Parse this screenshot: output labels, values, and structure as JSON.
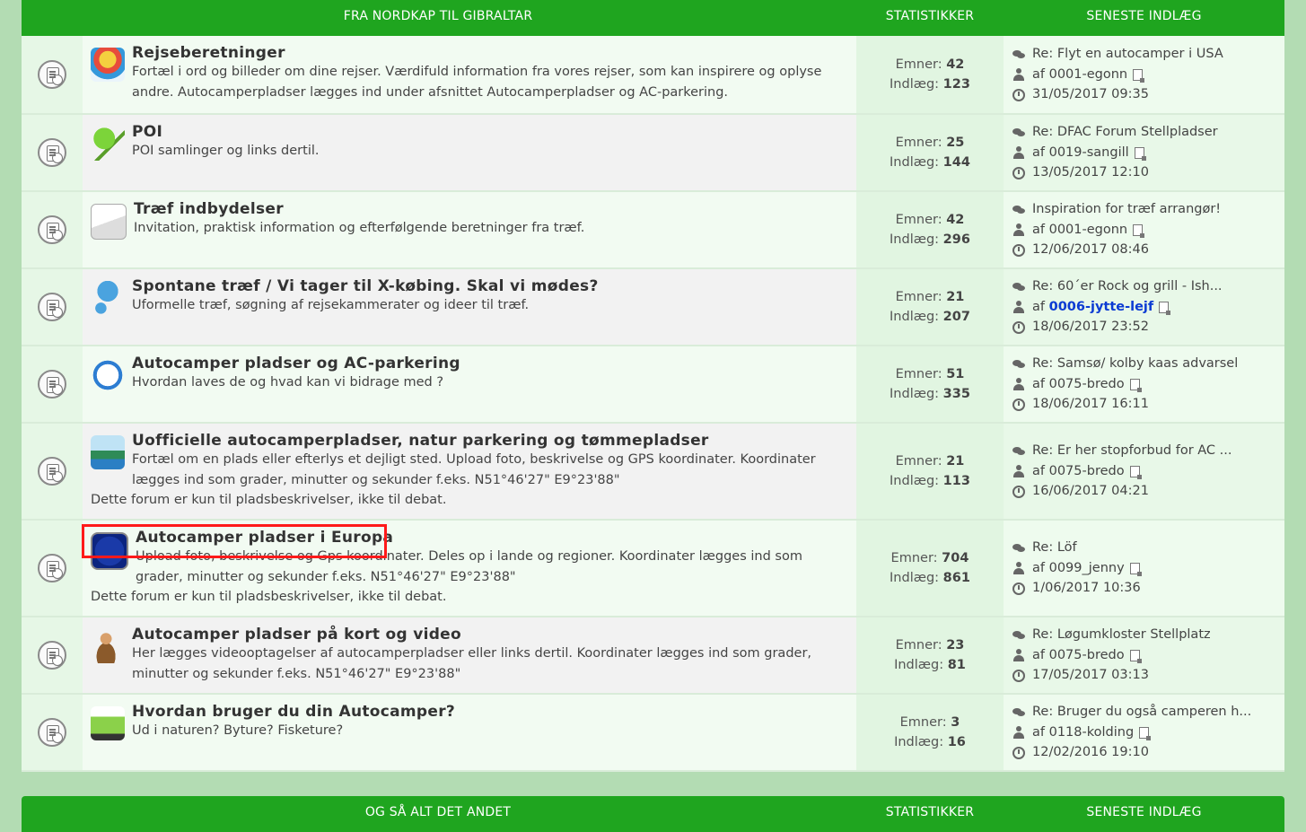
{
  "section1": {
    "header": {
      "title": "FRA NORDKAP TIL GIBRALTAR",
      "stats": "STATISTIKKER",
      "last": "SENESTE INDLÆG"
    },
    "rows": [
      {
        "title": "Rejseberetninger",
        "desc": "Fortæl i ord og billeder om dine rejser. Værdifuld information fra vores rejser, som kan inspirere og oplyse andre. Autocamperpladser lægges ind under afsnittet Autocamperpladser og AC-parkering.",
        "note": "",
        "topics_label": "Emner:",
        "topics": "42",
        "posts_label": "Indlæg:",
        "posts": "123",
        "last_title": "Re: Flyt en autocamper i USA",
        "by": "af",
        "last_user": "0001-egonn",
        "last_date": "31/05/2017 09:35",
        "icon": "hot-air-balloon-icon"
      },
      {
        "title": "POI",
        "desc": "POI samlinger og links dertil.",
        "note": "",
        "topics_label": "Emner:",
        "topics": "25",
        "posts_label": "Indlæg:",
        "posts": "144",
        "last_title": "Re: DFAC Forum Stellpladser",
        "by": "af",
        "last_user": "0019-sangill",
        "last_date": "13/05/2017 12:10",
        "icon": "pushpin-icon"
      },
      {
        "title": "Træf indbydelser",
        "desc": "Invitation, praktisk information og efterfølgende beretninger fra træf.",
        "note": "",
        "topics_label": "Emner:",
        "topics": "42",
        "posts_label": "Indlæg:",
        "posts": "296",
        "last_title": "Inspiration for træf arrangør!",
        "by": "af",
        "last_user": "0001-egonn",
        "last_date": "12/06/2017 08:46",
        "icon": "envelope-icon"
      },
      {
        "title": "Spontane træf / Vi tager til X-købing. Skal vi mødes?",
        "desc": "Uformelle træf, søgning af rejsekammerater og ideer til træf.",
        "note": "",
        "topics_label": "Emner:",
        "topics": "21",
        "posts_label": "Indlæg:",
        "posts": "207",
        "last_title": "Re: 60´er Rock og grill - Ish...",
        "by": "af",
        "last_user": "0006-jytte-lejf",
        "last_date": "18/06/2017 23:52",
        "icon": "umbrella-icon"
      },
      {
        "title": "Autocamper pladser og AC-parkering",
        "desc": "Hvordan laves de og hvad kan vi bidrage med ?",
        "note": "",
        "topics_label": "Emner:",
        "topics": "51",
        "posts_label": "Indlæg:",
        "posts": "335",
        "last_title": "Re: Samsø/ kolby kaas advarsel",
        "by": "af",
        "last_user": "0075-bredo",
        "last_date": "18/06/2017 16:11",
        "icon": "compass-icon"
      },
      {
        "title": "Uofficielle autocamperpladser, natur parkering og tømmepladser",
        "desc": "Fortæl om en plads eller efterlys et dejligt sted. Upload foto, beskrivelse og GPS koordinater. Koordinater lægges ind som grader, minutter og sekunder f.eks. N51°46'27\" E9°23'88\"",
        "note": "Dette forum er kun til pladsbeskrivelser, ikke til debat.",
        "topics_label": "Emner:",
        "topics": "21",
        "posts_label": "Indlæg:",
        "posts": "113",
        "last_title": "Re: Er her stopforbud for AC ...",
        "by": "af",
        "last_user": "0075-bredo",
        "last_date": "16/06/2017 04:21",
        "icon": "landscape-icon"
      },
      {
        "title": "Autocamper pladser i Europa",
        "desc": "Upload foto, beskrivelse og Gps koordinater. Deles op i lande og regioner. Koordinater lægges ind som grader, minutter og sekunder f.eks. N51°46'27\" E9°23'88\"",
        "note": "Dette forum er kun til pladsbeskrivelser, ikke til debat.",
        "topics_label": "Emner:",
        "topics": "704",
        "posts_label": "Indlæg:",
        "posts": "861",
        "last_title": "Re: Löf",
        "by": "af",
        "last_user": "0099_jenny",
        "last_date": "1/06/2017 10:36",
        "icon": "eu-flag-icon"
      },
      {
        "title": "Autocamper pladser på kort og video",
        "desc": "Her lægges videooptagelser af autocamperpladser eller links dertil. Koordinater lægges ind som grader, minutter og sekunder f.eks. N51°46'27\" E9°23'88\"",
        "note": "",
        "topics_label": "Emner:",
        "topics": "23",
        "posts_label": "Indlæg:",
        "posts": "81",
        "last_title": "Re: Løgumkloster Stellplatz",
        "by": "af",
        "last_user": "0075-bredo",
        "last_date": "17/05/2017 03:13",
        "icon": "video-person-icon"
      },
      {
        "title": "Hvordan bruger du din Autocamper?",
        "desc": "Ud i naturen? Byture? Fisketure?",
        "note": "",
        "topics_label": "Emner:",
        "topics": "3",
        "posts_label": "Indlæg:",
        "posts": "16",
        "last_title": "Re: Bruger du også camperen h...",
        "by": "af",
        "last_user": "0118-kolding",
        "last_date": "12/02/2016 19:10",
        "icon": "camper-van-icon"
      }
    ]
  },
  "section2": {
    "header": {
      "title": "OG SÅ ALT DET ANDET",
      "stats": "STATISTIKKER",
      "last": "SENESTE INDLÆG"
    }
  },
  "colors": {
    "header_green": "#1fa51f",
    "background": "#b3dcb3",
    "highlight": "#ff1a1a",
    "user_link": "#0b3bd3"
  }
}
